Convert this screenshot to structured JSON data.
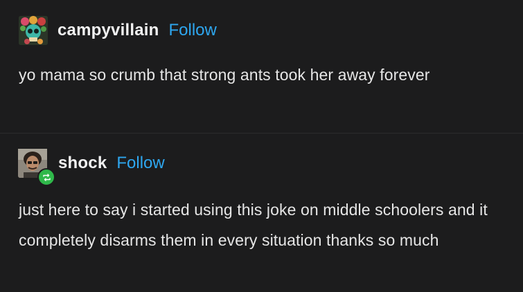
{
  "posts": [
    {
      "username": "campyvillain",
      "follow_label": "Follow",
      "text": "yo mama so crumb that strong ants took her away forever",
      "avatar_icon": "skull-flowers-avatar"
    },
    {
      "username": "shock",
      "follow_label": "Follow",
      "text": "just here to say i started using this joke on middle schoolers and it completely disarms them in every situation thanks so much",
      "avatar_icon": "portrait-avatar",
      "badge_icon": "reblog-icon"
    }
  ],
  "colors": {
    "background": "#1c1c1d",
    "follow": "#2ea7f0",
    "reblog_badge": "#2fb84a"
  }
}
